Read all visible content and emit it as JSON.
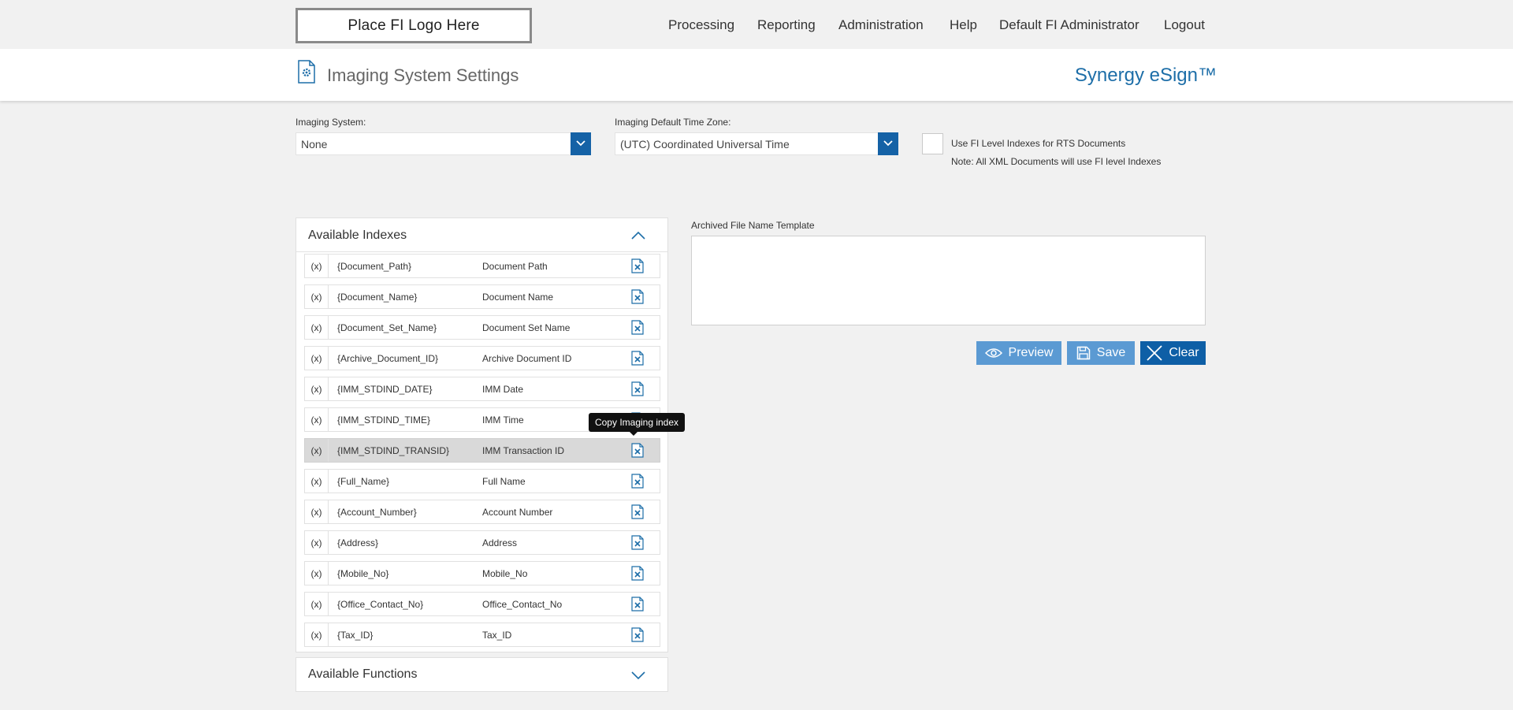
{
  "topbar": {
    "logo_text": "Place FI Logo Here",
    "nav": [
      "Processing",
      "Reporting",
      "Administration",
      "Help",
      "Default FI Administrator",
      "Logout"
    ]
  },
  "header": {
    "title": "Imaging System Settings",
    "brand": "Synergy eSign™"
  },
  "form": {
    "imaging_system_label": "Imaging System:",
    "imaging_system_value": "None",
    "timezone_label": "Imaging Default Time Zone:",
    "timezone_value": "(UTC) Coordinated Universal Time",
    "checkbox_label": "Use FI Level Indexes for RTS Documents",
    "checkbox_note": "Note: All XML Documents will use FI level Indexes",
    "checkbox_checked": false
  },
  "indexes": {
    "title": "Available Indexes",
    "x_label": "(x)",
    "items": [
      {
        "code": "{Document_Path}",
        "desc": "Document Path"
      },
      {
        "code": "{Document_Name}",
        "desc": "Document Name"
      },
      {
        "code": "{Document_Set_Name}",
        "desc": "Document Set Name"
      },
      {
        "code": "{Archive_Document_ID}",
        "desc": "Archive Document ID"
      },
      {
        "code": "{IMM_STDIND_DATE}",
        "desc": "IMM Date"
      },
      {
        "code": "{IMM_STDIND_TIME}",
        "desc": "IMM Time"
      },
      {
        "code": "{IMM_STDIND_TRANSID}",
        "desc": "IMM Transaction ID"
      },
      {
        "code": "{Full_Name}",
        "desc": "Full Name"
      },
      {
        "code": "{Account_Number}",
        "desc": "Account Number"
      },
      {
        "code": "{Address}",
        "desc": "Address"
      },
      {
        "code": "{Mobile_No}",
        "desc": "Mobile_No"
      },
      {
        "code": "{Office_Contact_No}",
        "desc": "Office_Contact_No"
      },
      {
        "code": "{Tax_ID}",
        "desc": "Tax_ID"
      }
    ],
    "tooltip": "Copy Imaging index"
  },
  "functions": {
    "title": "Available Functions"
  },
  "template": {
    "label": "Archived File Name Template",
    "value": ""
  },
  "buttons": {
    "preview": "Preview",
    "save": "Save",
    "clear": "Clear"
  },
  "colors": {
    "accent": "#1562a6",
    "brand": "#1d6ea8",
    "button_light": "#5b9ad3",
    "button_dark": "#0e5fa6"
  }
}
